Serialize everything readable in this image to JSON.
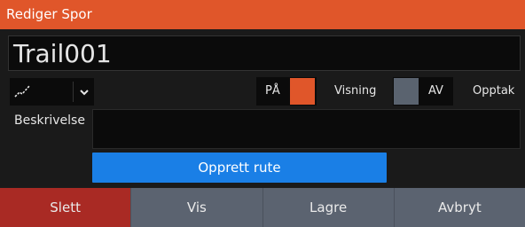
{
  "dialog": {
    "title": "Rediger Spor",
    "name_value": "Trail001",
    "toggles": {
      "on_label": "PÅ",
      "on_color": "#e0562a",
      "visning_label": "Visning",
      "off_label": "AV",
      "off_color": "#5a636f",
      "opptak_label": "Opptak"
    },
    "description": {
      "label": "Beskrivelse",
      "value": ""
    },
    "create_route_label": "Opprett rute"
  },
  "bottom_buttons": {
    "delete": "Slett",
    "show": "Vis",
    "save": "Lagre",
    "cancel": "Avbryt"
  },
  "colors": {
    "titlebar": "#e0562a",
    "primary_button": "#1a7fe6",
    "delete_button": "#a92a24",
    "bottom_button": "#5b6370"
  },
  "icons": {
    "line_style": "line-style-icon",
    "dropdown": "chevron-down-icon"
  }
}
